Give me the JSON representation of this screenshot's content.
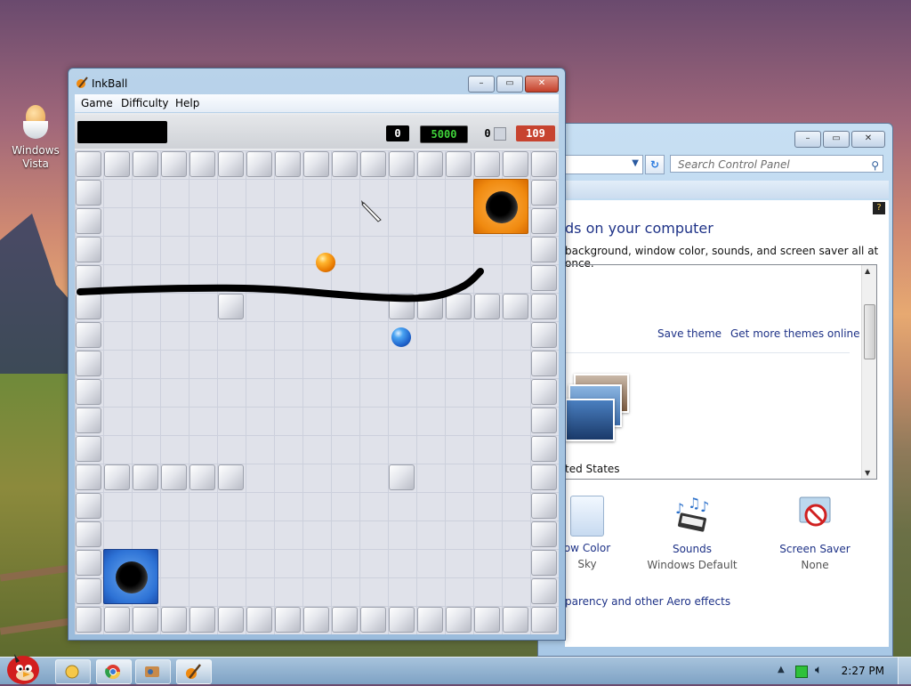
{
  "desktop": {
    "icon_label": "Windows Vista"
  },
  "control_panel": {
    "search_placeholder": "Search Control Panel",
    "heading": "ds on your computer",
    "description": "background, window color, sounds, and screen saver all at once.",
    "save_theme": "Save theme",
    "get_more_themes": "Get more themes online",
    "theme_name": "ted States",
    "window_color_label": "ow Color",
    "window_color_sub": "Sky",
    "sounds_label": "Sounds",
    "sounds_sub": "Windows Default",
    "screensaver_label": "Screen Saver",
    "screensaver_sub": "None",
    "aero_link": "parency and other Aero effects"
  },
  "inkball": {
    "title": "InkBall",
    "menu": [
      "Game",
      "Difficulty",
      "Help"
    ],
    "score": "0",
    "target_score": "5000",
    "ink_count": "0",
    "time": "109",
    "colors": {
      "orange": "#f08a10",
      "blue": "#2e73d6",
      "time_bg": "#c7432f",
      "target_fg": "#3fd23a"
    }
  },
  "taskbar": {
    "clock": "2:27 PM"
  }
}
